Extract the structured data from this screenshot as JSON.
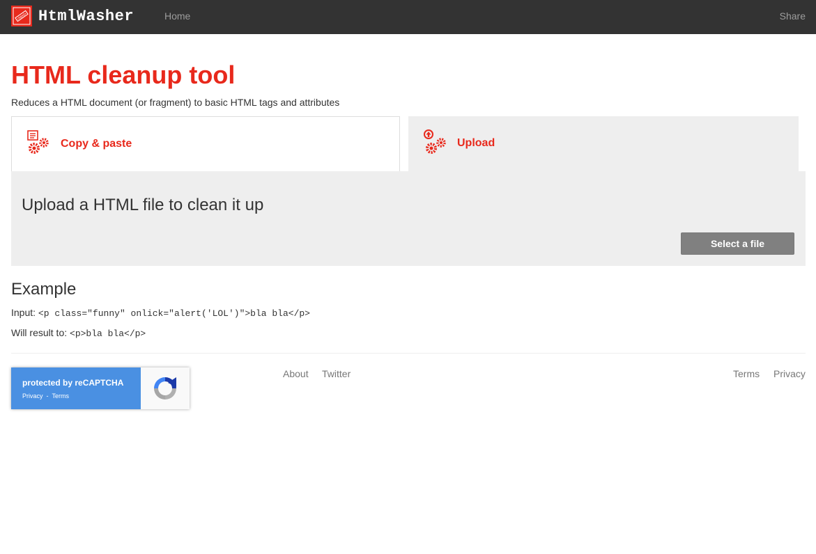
{
  "nav": {
    "brand": "HtmlWasher",
    "home": "Home",
    "share": "Share"
  },
  "page": {
    "title": "HTML cleanup tool",
    "subtitle": "Reduces a HTML document (or fragment) to basic HTML tags and attributes"
  },
  "tabs": [
    {
      "label": "Copy & paste",
      "icon": "document-gears-icon",
      "active": false
    },
    {
      "label": "Upload",
      "icon": "upload-gears-icon",
      "active": true
    }
  ],
  "upload": {
    "heading": "Upload a HTML file to clean it up",
    "button": "Select a file"
  },
  "example": {
    "heading": "Example",
    "input_label": "Input: ",
    "input_code": "<p class=\"funny\" onlick=\"alert('LOL')\">bla bla</p>",
    "result_label": "Will result to: ",
    "result_code": "<p>bla bla</p>"
  },
  "recaptcha": {
    "text": "protected by reCAPTCHA",
    "privacy": "Privacy",
    "separator": "-",
    "terms": "Terms"
  },
  "footer": {
    "about": "About",
    "twitter": "Twitter",
    "terms": "Terms",
    "privacy": "Privacy"
  },
  "colors": {
    "accent": "#e8291c",
    "navbar": "#333333",
    "panel": "#eeeeee",
    "button": "#808080",
    "recaptcha": "#4a90e2"
  }
}
